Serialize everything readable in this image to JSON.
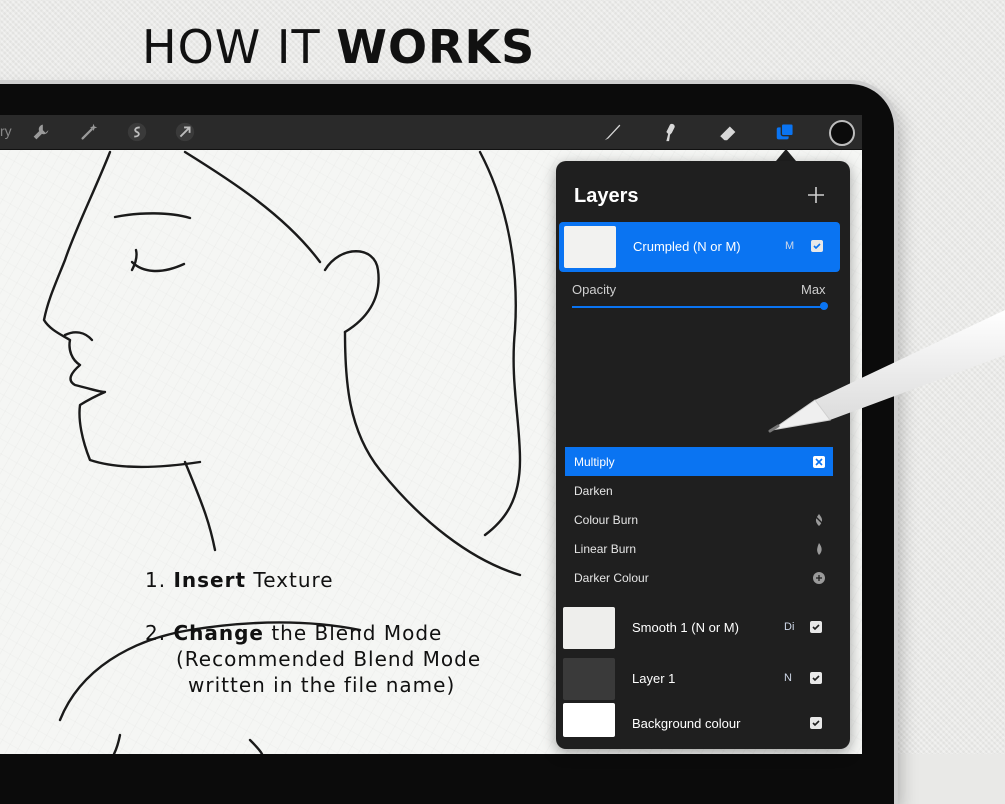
{
  "headline": {
    "light": "HOW IT",
    "bold": "WORKS"
  },
  "toolbar": {
    "gallery_fragment": "ry",
    "left_icons": [
      "wrench-icon",
      "magic-wand-icon",
      "selection-icon",
      "transform-arrow-icon"
    ],
    "right_icons": [
      "brush-icon",
      "smudge-icon",
      "eraser-icon",
      "layers-icon"
    ],
    "current_color": "#0b0b0b"
  },
  "layers_panel": {
    "title": "Layers",
    "add_label": "+",
    "selected_layer": {
      "name": "Crumpled (N or M)",
      "mode": "M",
      "visible": true
    },
    "opacity_label": "Opacity",
    "opacity_value_label": "Max",
    "opacity": 1.0,
    "blend_modes": [
      {
        "label": "Multiply",
        "icon": "multiply-icon",
        "active": true
      },
      {
        "label": "Darken",
        "icon": "darken-icon",
        "active": false
      },
      {
        "label": "Colour Burn",
        "icon": "colour-burn-icon",
        "active": false
      },
      {
        "label": "Linear Burn",
        "icon": "linear-burn-icon",
        "active": false
      },
      {
        "label": "Darker Colour",
        "icon": "darker-colour-icon",
        "active": false
      }
    ],
    "layers": [
      {
        "name": "Smooth 1 (N or M)",
        "mode": "Di",
        "visible": true
      },
      {
        "name": "Layer 1",
        "mode": "N",
        "visible": true
      },
      {
        "name": "Background colour",
        "mode": "",
        "visible": true
      }
    ]
  },
  "instructions": {
    "step1_num": "1.",
    "step1_bold": "Insert",
    "step1_rest": "Texture",
    "step2_num": "2.",
    "step2_bold": "Change",
    "step2_rest": "the Blend Mode",
    "step2_line2": "(Recommended Blend Mode",
    "step2_line3": "written in the file name)"
  },
  "colors": {
    "accent": "#0a74f2",
    "panel_bg": "#1f1f1f",
    "toolbar_bg": "#2a2a2a",
    "device_frame": "#0b0b0b",
    "paper": "#f5f6f4"
  }
}
